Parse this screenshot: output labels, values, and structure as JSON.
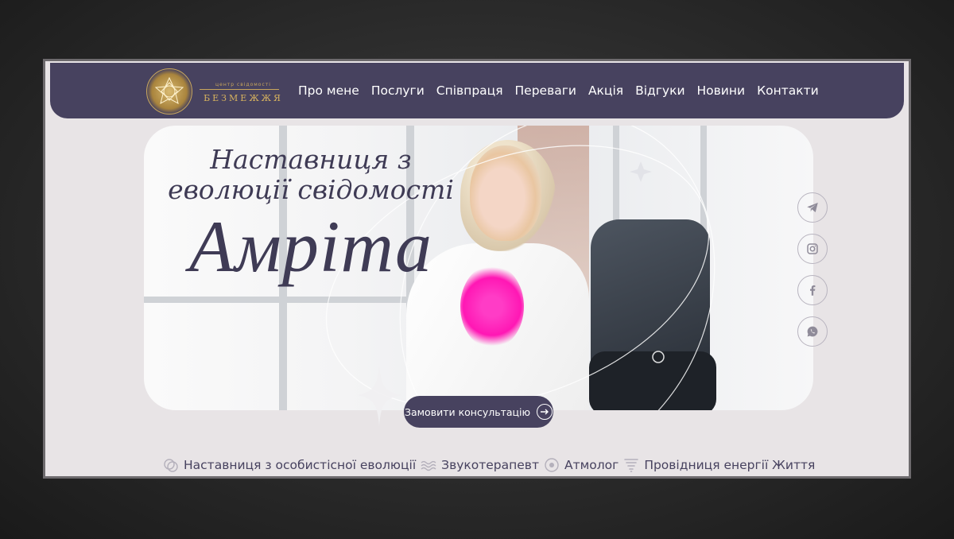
{
  "brand": {
    "tagline": "центр свідомості",
    "name": "БЕЗМЕЖЖЯ",
    "logo_icon": "mandala-icon"
  },
  "nav": {
    "items": [
      "Про мене",
      "Послуги",
      "Співпраця",
      "Переваги",
      "Акція",
      "Відгуки",
      "Новини",
      "Контакти"
    ]
  },
  "hero": {
    "subtitle_line1": "Наставниця з",
    "subtitle_line2": "еволюції свідомості",
    "name": "Амріта"
  },
  "social": [
    {
      "icon": "telegram-icon"
    },
    {
      "icon": "instagram-icon"
    },
    {
      "icon": "facebook-icon"
    },
    {
      "icon": "whatsapp-icon"
    }
  ],
  "cta": {
    "label": "Замовити консультацію",
    "icon": "arrow-right-icon"
  },
  "roles": [
    {
      "icon": "circles-icon",
      "label": "Наставниця з особистісної еволюції"
    },
    {
      "icon": "waves-icon",
      "label": "Звукотерапевт"
    },
    {
      "icon": "target-icon",
      "label": "Атмолог"
    },
    {
      "icon": "tornado-icon",
      "label": "Провідниця енергії Життя"
    }
  ],
  "colors": {
    "primary": "#47425f",
    "gold": "#c9a75c",
    "background": "#e8e4e6",
    "accent_pink": "#ff17b4"
  }
}
